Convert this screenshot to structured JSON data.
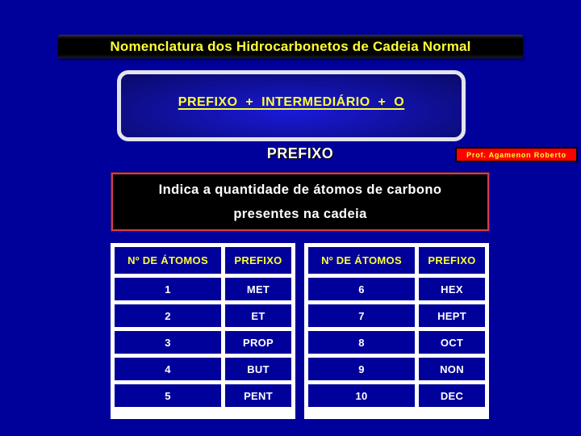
{
  "title": "Nomenclatura dos Hidrocarbonetos de Cadeia Normal",
  "formula": "PREFIXO  +  INTERMEDIÁRIO  +  O",
  "section_title": "PREFIXO",
  "author": "Prof. Agamenon Roberto",
  "description": {
    "line1": "Indica a quantidade de átomos de carbono",
    "line2": "presentes na cadeia"
  },
  "colors": {
    "background": "#00009a",
    "title_text": "#ffff33",
    "badge": "#ff0000",
    "table_grid": "#ffffff"
  },
  "tables": [
    {
      "headers": [
        "Nº DE ÁTOMOS",
        "PREFIXO"
      ],
      "rows": [
        [
          "1",
          "MET"
        ],
        [
          "2",
          "ET"
        ],
        [
          "3",
          "PROP"
        ],
        [
          "4",
          "BUT"
        ],
        [
          "5",
          "PENT"
        ]
      ]
    },
    {
      "headers": [
        "Nº DE ÁTOMOS",
        "PREFIXO"
      ],
      "rows": [
        [
          "6",
          "HEX"
        ],
        [
          "7",
          "HEPT"
        ],
        [
          "8",
          "OCT"
        ],
        [
          "9",
          "NON"
        ],
        [
          "10",
          "DEC"
        ]
      ]
    }
  ]
}
